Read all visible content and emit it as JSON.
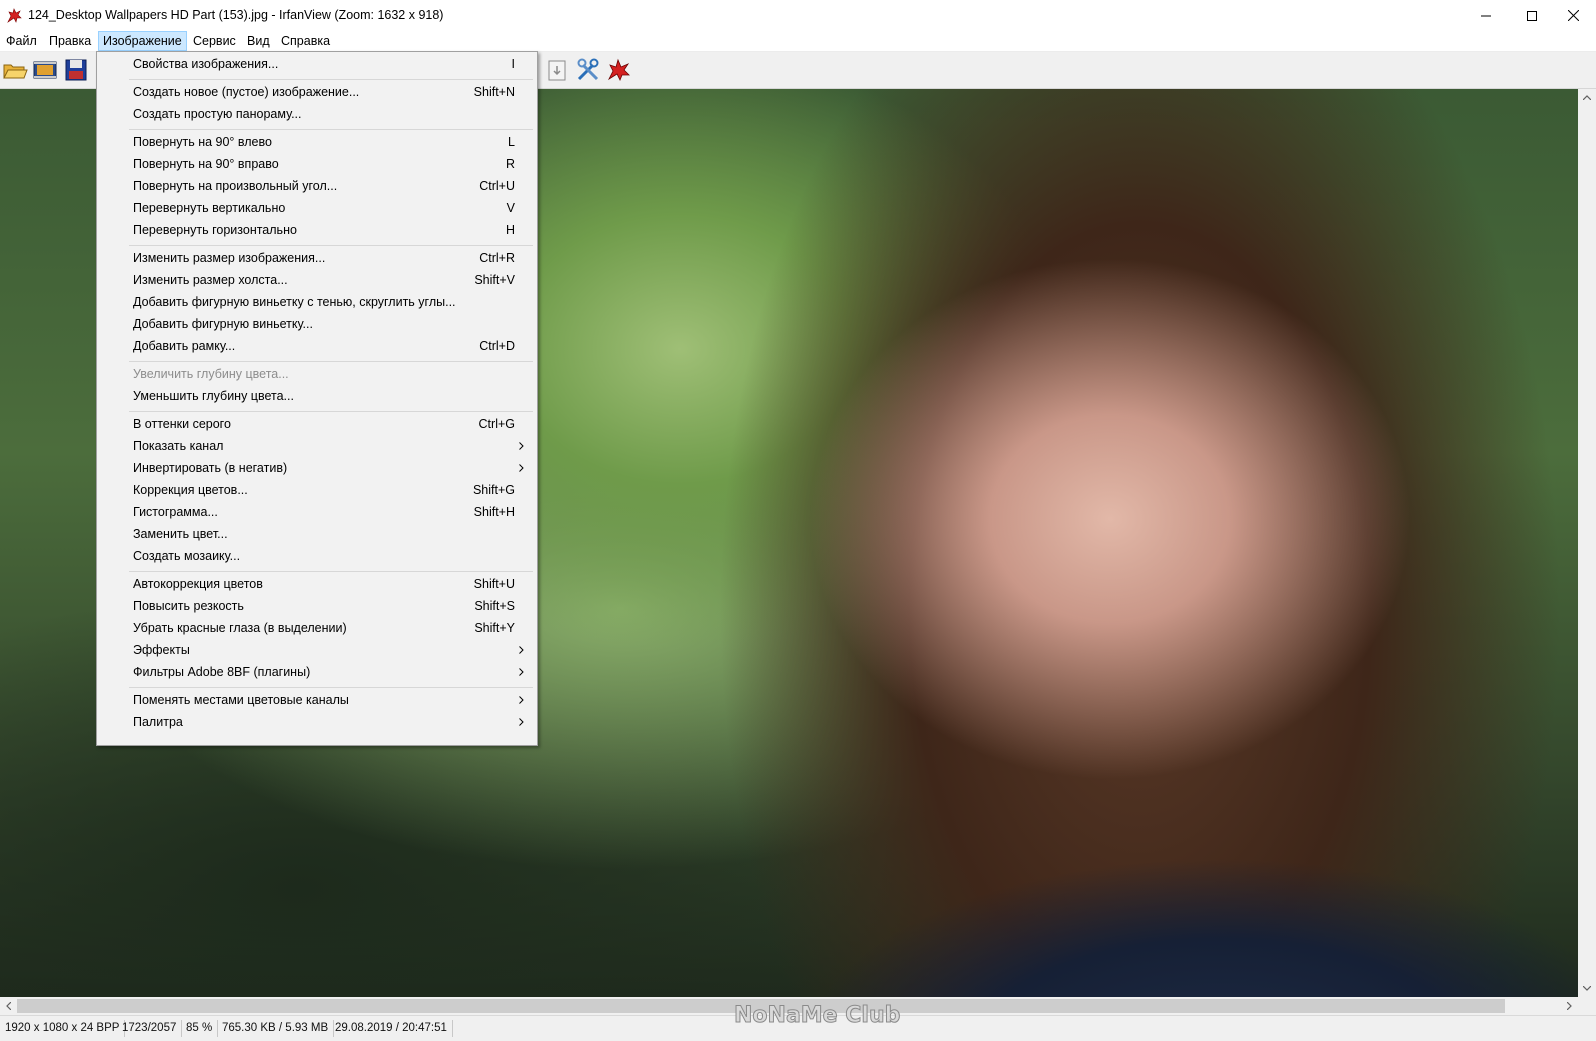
{
  "window": {
    "title": "124_Desktop Wallpapers  HD Part (153).jpg - IrfanView (Zoom: 1632 x 918)"
  },
  "menubar": {
    "items": [
      "Файл",
      "Правка",
      "Изображение",
      "Сервис",
      "Вид",
      "Справка"
    ],
    "active_index": 2
  },
  "toolbar": {
    "icons": [
      "open-folder-icon",
      "slideshow-icon",
      "save-icon",
      "page-icon",
      "tools-icon",
      "irfanview-logo-icon"
    ]
  },
  "image_menu": {
    "items": [
      {
        "label": "Свойства изображения...",
        "shortcut": "I"
      },
      {
        "label": "Создать новое (пустое) изображение...",
        "shortcut": "Shift+N"
      },
      {
        "label": "Создать простую панораму...",
        "shortcut": ""
      },
      {
        "label": "Повернуть на 90° влево",
        "shortcut": "L"
      },
      {
        "label": "Повернуть на 90° вправо",
        "shortcut": "R"
      },
      {
        "label": "Повернуть на произвольный угол...",
        "shortcut": "Ctrl+U"
      },
      {
        "label": "Перевернуть вертикально",
        "shortcut": "V"
      },
      {
        "label": "Перевернуть горизонтально",
        "shortcut": "H"
      },
      {
        "label": "Изменить размер изображения...",
        "shortcut": "Ctrl+R"
      },
      {
        "label": "Изменить размер холста...",
        "shortcut": "Shift+V"
      },
      {
        "label": "Добавить фигурную виньетку с тенью, скруглить углы...",
        "shortcut": ""
      },
      {
        "label": "Добавить фигурную виньетку...",
        "shortcut": ""
      },
      {
        "label": "Добавить рамку...",
        "shortcut": "Ctrl+D"
      },
      {
        "label": "Увеличить глубину цвета...",
        "shortcut": "",
        "disabled": true
      },
      {
        "label": "Уменьшить глубину цвета...",
        "shortcut": ""
      },
      {
        "label": "В оттенки серого",
        "shortcut": "Ctrl+G"
      },
      {
        "label": "Показать канал",
        "shortcut": "",
        "submenu": true
      },
      {
        "label": "Инвертировать (в негатив)",
        "shortcut": "",
        "submenu": true
      },
      {
        "label": "Коррекция цветов...",
        "shortcut": "Shift+G"
      },
      {
        "label": "Гистограмма...",
        "shortcut": "Shift+H"
      },
      {
        "label": "Заменить цвет...",
        "shortcut": ""
      },
      {
        "label": "Создать мозаику...",
        "shortcut": ""
      },
      {
        "label": "Автокоррекция цветов",
        "shortcut": "Shift+U"
      },
      {
        "label": "Повысить резкость",
        "shortcut": "Shift+S"
      },
      {
        "label": "Убрать красные глаза (в выделении)",
        "shortcut": "Shift+Y"
      },
      {
        "label": "Эффекты",
        "shortcut": "",
        "submenu": true
      },
      {
        "label": "Фильтры Adobe 8BF (плагины)",
        "shortcut": "",
        "submenu": true
      },
      {
        "label": "Поменять местами цветовые каналы",
        "shortcut": "",
        "submenu": true
      },
      {
        "label": "Палитра",
        "shortcut": "",
        "submenu": true
      }
    ]
  },
  "statusbar": {
    "dimensions": "1920 x 1080 x 24 BPP",
    "index": "1723/2057",
    "zoom": "85 %",
    "filesize": "765.30 KB / 5.93 MB",
    "datetime": "29.08.2019 / 20:47:51"
  },
  "watermark": "NoNaMe Club",
  "colors": {
    "menu_active_bg": "#cce8ff",
    "menu_bg": "#f2f2f2",
    "disabled_text": "#8d8d8d"
  }
}
